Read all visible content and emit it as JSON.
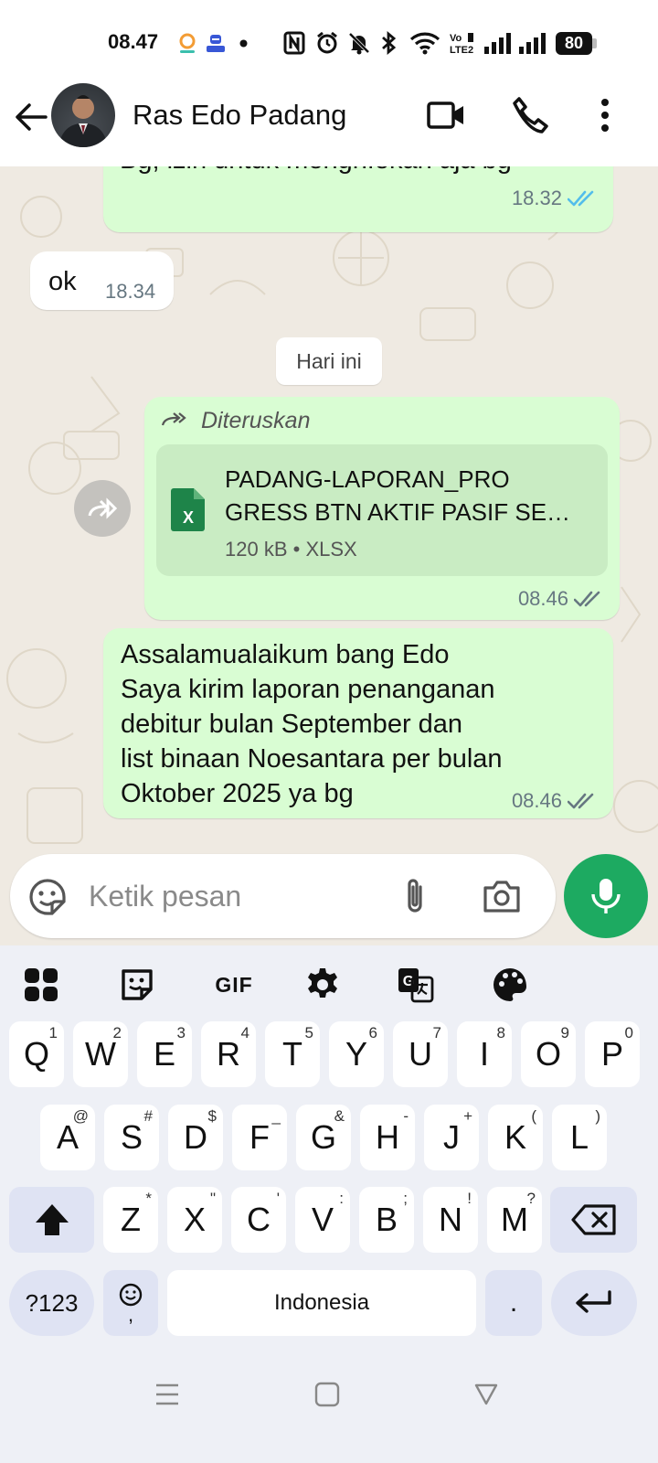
{
  "status_bar": {
    "time": "08.47",
    "battery": "80",
    "icons": [
      "nfc-icon",
      "alarm-icon",
      "mute-icon",
      "bluetooth-icon",
      "wifi-icon",
      "volte-icon",
      "signal-icon",
      "signal-icon",
      "battery-icon"
    ]
  },
  "header": {
    "contact_name": "Ras Edo Padang",
    "icons": [
      "back-arrow-icon",
      "video-call-icon",
      "voice-call-icon",
      "more-options-icon"
    ]
  },
  "chat": {
    "messages": [
      {
        "direction": "out",
        "text": "Bg, izin untuk menghfokan aja bg",
        "time": "18.32",
        "status": "read"
      },
      {
        "direction": "in",
        "text": "ok",
        "time": "18.34"
      }
    ],
    "date_separator": "Hari ini",
    "forwarded_message": {
      "forward_label": "Diteruskan",
      "file_name_line1": "PADANG-LAPORAN_PRO",
      "file_name_line2": "GRESS BTN AKTIF PASIF SE…",
      "file_size": "120 kB",
      "file_type": "XLSX",
      "time": "08.46",
      "status": "delivered"
    },
    "text_message": {
      "lines": [
        "Assalamualaikum bang Edo",
        "Saya kirim laporan penanganan",
        "debitur bulan September dan",
        "list binaan Noesantara per bulan",
        "Oktober 2025 ya bg"
      ],
      "time": "08.46",
      "status": "delivered"
    }
  },
  "composer": {
    "placeholder": "Ketik pesan"
  },
  "keyboard": {
    "toolbar": [
      "apps-grid-icon",
      "sticker-icon",
      "GIF",
      "settings-icon",
      "translate-icon",
      "palette-icon"
    ],
    "gif_label": "GIF",
    "row1": [
      {
        "k": "Q",
        "h": "1"
      },
      {
        "k": "W",
        "h": "2"
      },
      {
        "k": "E",
        "h": "3"
      },
      {
        "k": "R",
        "h": "4"
      },
      {
        "k": "T",
        "h": "5"
      },
      {
        "k": "Y",
        "h": "6"
      },
      {
        "k": "U",
        "h": "7"
      },
      {
        "k": "I",
        "h": "8"
      },
      {
        "k": "O",
        "h": "9"
      },
      {
        "k": "P",
        "h": "0"
      }
    ],
    "row2": [
      {
        "k": "A",
        "h": "@"
      },
      {
        "k": "S",
        "h": "#"
      },
      {
        "k": "D",
        "h": "$"
      },
      {
        "k": "F",
        "h": "_"
      },
      {
        "k": "G",
        "h": "&"
      },
      {
        "k": "H",
        "h": "-"
      },
      {
        "k": "J",
        "h": "+"
      },
      {
        "k": "K",
        "h": "("
      },
      {
        "k": "L",
        "h": ")"
      }
    ],
    "row3": [
      {
        "k": "Z",
        "h": "*"
      },
      {
        "k": "X",
        "h": "\""
      },
      {
        "k": "C",
        "h": "'"
      },
      {
        "k": "V",
        "h": ":"
      },
      {
        "k": "B",
        "h": ";"
      },
      {
        "k": "N",
        "h": "!"
      },
      {
        "k": "M",
        "h": "?"
      }
    ],
    "symbols_key": "?123",
    "emoji_key_sub": ",",
    "space_label": "Indonesia",
    "period_key": "."
  },
  "colors": {
    "accent_green": "#1daa61",
    "outgoing_bubble": "#d9fdd3",
    "read_tick": "#53bdeb",
    "chat_background": "#efeae2"
  }
}
